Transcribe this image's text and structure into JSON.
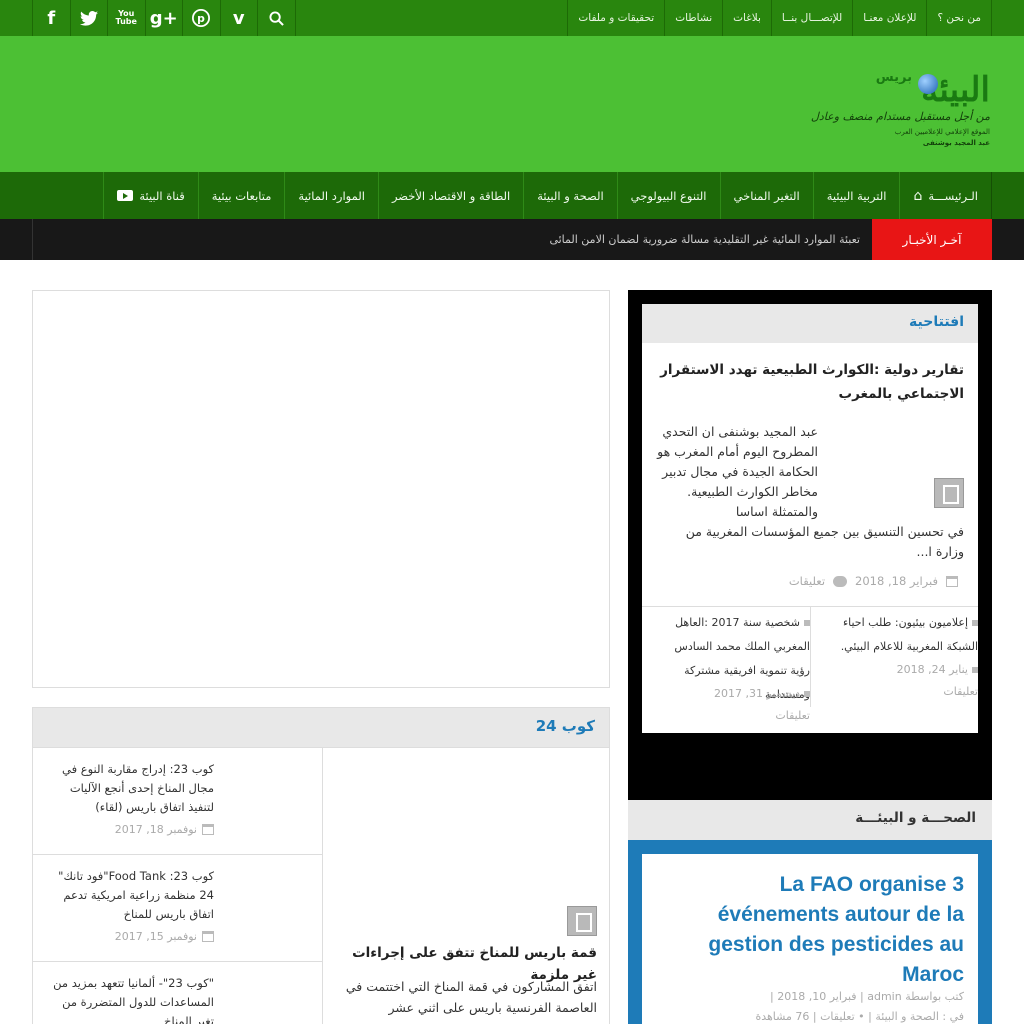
{
  "topbar": {
    "social": [
      "f",
      "t",
      "You Tube",
      "g+",
      "p",
      "v",
      "search"
    ],
    "menu": [
      "من نحن ؟",
      "للإعلان معنـا",
      "للإتصـــال بنــا",
      "بلاغات",
      "نشاطات",
      "تحقيقات و ملفات"
    ]
  },
  "logo": {
    "main": "البيئة",
    "press": "بريس",
    "tagline": "من أجل مستقبل مستدام منصف وعادل",
    "sub1": "الموقع الإعلامي للإعلاميين العرب",
    "sub2": "عبد المجيد بوشنفى"
  },
  "mainnav": [
    "الـرئيســـة",
    "التربية البيئية",
    "التغير المناخي",
    "التنوع البيولوجي",
    "الصحة و البيئة",
    "الطاقة و الاقتصاد الأخضر",
    "الموارد المائية",
    "متابعات بيئية",
    "قناة البيئة"
  ],
  "breaking": {
    "label": "آخـر الأخبـار",
    "ticker": "تعبئة الموارد المائية غير التقليدية مسالة ضرورية لضمان الامن المائى"
  },
  "cop": {
    "title": "كوب 24",
    "items": [
      {
        "text": "كوب 23: إدراج مقاربة النوع في مجال المناخ إحدى أنجع الآليات لتنفيذ اتفاق باريس (لقاء)",
        "date": "نوفمبر 18, 2017"
      },
      {
        "text": "كوب 23: Food Tank\"فود تانك\" 24 منظمة زراعية امريكية تدعم اتفاق باريس للمناخ",
        "date": "نوفمبر 15, 2017"
      },
      {
        "text": "\"كوب 23\"- ألمانيا تتعهد بمزيد من المساعدات للدول المتضررة من تغير المناخ",
        "date": ""
      }
    ],
    "big_title": "قمة باريس للمناخ تتفق على إجراءات غير ملزمة",
    "big_excerpt": "اتفق المشاركون في قمة المناخ التي اختتمت في العاصمة الفرنسية باريس على اثني عشر"
  },
  "editorial": {
    "title": "افتتاحية",
    "headline": "تقارير دولية :الكوارث الطبيعية تهدد الاستقرار الاجتماعي بالمغرب",
    "excerpt1": "عبد المجيد بوشنفى ان التحدي المطروح اليوم أمام المغرب هو الحكامة الجيدة في مجال تدبير مخاطر الكوارث الطبيعية. والمتمثلة اساسا",
    "excerpt2": "في تحسين التنسيق بين جميع المؤسسات المغربية من وزارة ا...",
    "date": "فبراير 18, 2018",
    "comments": "تعليقات",
    "col_right": {
      "text": "إعلاميون بيئيون: طلب احياء الشبكة المغربية للاعلام البيئي.",
      "date": "يناير 24, 2018",
      "comments": "تعليقات"
    },
    "col_left": {
      "text": "شخصية سنة 2017 :العاهل المغربي الملك محمد السادس رؤية تنموية افريقية مشتركة ومستدامة",
      "date": "ديسمبر 31, 2017",
      "comments": "تعليقات"
    }
  },
  "health": {
    "title": "الصحـــة و البيئـــة",
    "headline": "La FAO organise 3 événements autour de la gestion des pesticides au Maroc",
    "meta1": "كتب بواسطة admin | فبراير 10, 2018 |",
    "meta2": "في : الصحة و البيئة | • تعليقات | 76 مشاهدة"
  }
}
